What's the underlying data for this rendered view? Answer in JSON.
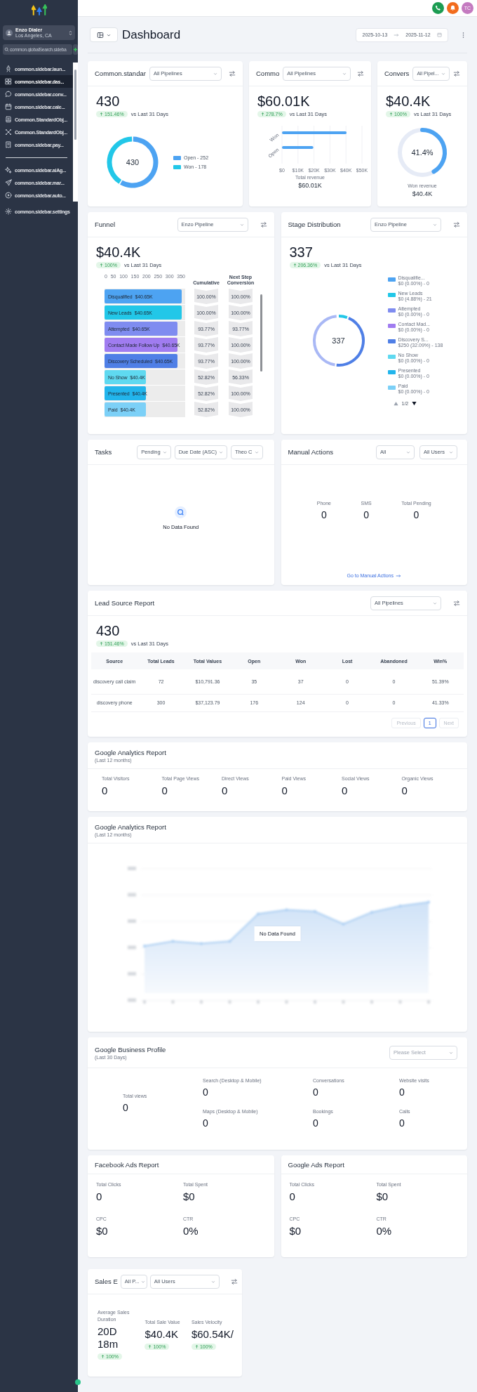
{
  "topbar": {
    "avatar": "TC"
  },
  "sidebar": {
    "workspace": {
      "name": "Enzo Dialer",
      "location": "Los Angeles, CA"
    },
    "search": {
      "placeholder": "common.globalSearch.sideba"
    },
    "nav_groups": [
      {
        "items": [
          {
            "label": "common.sidebar.laun...",
            "selected": false
          },
          {
            "label": "common.sidebar.das...",
            "selected": true
          },
          {
            "label": "common.sidebar.conv...",
            "selected": false
          },
          {
            "label": "common.sidebar.cale...",
            "selected": false
          },
          {
            "label": "Common.StandardObj...",
            "selected": false
          },
          {
            "label": "Common.StandardObj...",
            "selected": false
          },
          {
            "label": "common.sidebar.pay...",
            "selected": false
          }
        ]
      },
      {
        "items": [
          {
            "label": "common.sidebar.aiAg...",
            "selected": false
          },
          {
            "label": "common.sidebar.mar...",
            "selected": false
          },
          {
            "label": "common.sidebar.auto...",
            "selected": false
          }
        ]
      }
    ],
    "footer_items": [
      {
        "label": "common.sidebar.settings",
        "selected": false
      }
    ]
  },
  "header": {
    "title": "Dashboard",
    "date_start": "2025-10-13",
    "date_end": "2025-11-12"
  },
  "opportunities_card": {
    "title": "Common.standar",
    "pipeline": "All Pipelines",
    "value": "430",
    "change": "151.46%",
    "comparison": "vs Last 31 Days",
    "center_label": "430",
    "chart_data": {
      "type": "donut",
      "categories": [
        "Open - 252",
        "Won - 178"
      ],
      "values": [
        58.6,
        41.4
      ],
      "legend": "right"
    }
  },
  "revenue_card": {
    "title": "Commo",
    "pipeline": "All Pipelines",
    "value": "$60.01K",
    "change": "278.7%",
    "comparison": "vs Last 31 Days",
    "chart_data": {
      "type": "bar",
      "orientation": "horizontal",
      "grid": true,
      "categories": [
        "Won",
        "Open"
      ],
      "series": [
        {
          "color": "#4da3f2",
          "values": [
            40.4,
            19.6
          ]
        }
      ],
      "xlim": [
        0,
        50
      ],
      "xticks": [
        {
          "value": 0,
          "label": "$0"
        },
        {
          "value": 10,
          "label": "$10K"
        },
        {
          "value": 20,
          "label": "$20K"
        },
        {
          "value": 30,
          "label": "$30K"
        },
        {
          "value": 40,
          "label": "$40K"
        },
        {
          "value": 50,
          "label": "$50K"
        }
      ]
    },
    "total_label": "Total revenue",
    "total_value": "$60.01K"
  },
  "conversion_card": {
    "title": "Convers",
    "pipeline": "All Pipel...",
    "value": "$40.4K",
    "change": "100%",
    "comparison": "vs Last 31 Days",
    "ring": {
      "level": 0.414,
      "label": "41.4%"
    },
    "caption": "Won revenue",
    "caption_value": "$40.4K"
  },
  "funnel": {
    "title": "Funnel",
    "pipeline": "Enzo Pipeline",
    "value": "$40.4K",
    "change": "100%",
    "comparison": "vs Last 31 Days",
    "axis_ticks": [
      "0",
      "50",
      "100",
      "150",
      "200",
      "250",
      "300",
      "350"
    ],
    "columns": [
      "Cumulative",
      "Next Step Conversion"
    ],
    "stages": [
      {
        "name": "Disqualified",
        "amount": "$40.65K",
        "level": 0.96,
        "color": "#4da3f2",
        "cumulative": "100.00%",
        "next_step": "100.00%"
      },
      {
        "name": "New Leads",
        "amount": "$40.65K",
        "level": 0.96,
        "color": "#22c7e8",
        "cumulative": "100.00%",
        "next_step": "100.00%"
      },
      {
        "name": "Attempted",
        "amount": "$40.65K",
        "level": 0.9,
        "color": "#7f8cf0",
        "cumulative": "93.77%",
        "next_step": "93.77%"
      },
      {
        "name": "Contact Made Follow Up",
        "amount": "$40.65K",
        "level": 0.9,
        "color": "#a07cf0",
        "cumulative": "93.77%",
        "next_step": "100.00%"
      },
      {
        "name": "Discovery Scheduled",
        "amount": "$40.65K",
        "level": 0.9,
        "color": "#4f7fe6",
        "cumulative": "93.77%",
        "next_step": "100.00%"
      },
      {
        "name": "No Show",
        "amount": "$40.4K",
        "level": 0.51,
        "color": "#5fd9f0",
        "cumulative": "52.82%",
        "next_step": "56.33%"
      },
      {
        "name": "Presented",
        "amount": "$40.4K",
        "level": 0.51,
        "color": "#22b5ec",
        "cumulative": "52.82%",
        "next_step": "100.00%"
      },
      {
        "name": "Paid",
        "amount": "$40.4K",
        "level": 0.51,
        "color": "#7cd0f7",
        "cumulative": "52.82%",
        "next_step": "100.00%"
      }
    ]
  },
  "stage_distribution": {
    "title": "Stage Distribution",
    "pipeline": "Enzo Pipeline",
    "value": "337",
    "change": "206.36%",
    "comparison": "vs Last 31 Days",
    "center_label": "337",
    "legend": [
      {
        "name": "Disqualifie...",
        "detail": "$0 (0.00%) - 0",
        "color": "#4da3f2"
      },
      {
        "name": "New Leads",
        "detail": "$0 (4.88%) - 21",
        "color": "#22c7e8"
      },
      {
        "name": "Attempted",
        "detail": "$0 (0.00%) - 0",
        "color": "#7f8cf0"
      },
      {
        "name": "Contact Mad...",
        "detail": "$0 (0.00%) - 0",
        "color": "#a07cf0"
      },
      {
        "name": "Discovery S...",
        "detail": "$250 (32.09%) - 138",
        "color": "#4f7fe6"
      },
      {
        "name": "No Show",
        "detail": "$0 (0.00%) - 0",
        "color": "#5fd9f0"
      },
      {
        "name": "Presented",
        "detail": "$0 (0.00%) - 0",
        "color": "#22b5ec"
      },
      {
        "name": "Paid",
        "detail": "$0 (0.00%) - 0",
        "color": "#7cd0f7"
      }
    ],
    "pager": {
      "label": "1/2",
      "previous_disabled": true,
      "next_disabled": false
    }
  },
  "tasks": {
    "title": "Tasks",
    "filters": [
      "Pending",
      "Due Date (ASC)",
      "Theo C"
    ],
    "empty_text": "No Data Found"
  },
  "manual_actions": {
    "title": "Manual Actions",
    "filters": [
      "All",
      "All Users"
    ],
    "stats": [
      {
        "label": "Phone",
        "value": "0"
      },
      {
        "label": "SMS",
        "value": "0"
      },
      {
        "label": "Total Pending",
        "value": "0"
      }
    ],
    "link": "Go to Manual Actions"
  },
  "lead_source": {
    "title": "Lead Source Report",
    "pipeline": "All Pipelines",
    "value": "430",
    "change": "151.46%",
    "comparison": "vs Last 31 Days",
    "table": {
      "columns": [
        "Source",
        "Total Leads",
        "Total Values",
        "Open",
        "Won",
        "Lost",
        "Abandoned",
        "Win%"
      ],
      "rows": [
        [
          "discovery call claim",
          "72",
          "$10,791.36",
          "35",
          "37",
          "0",
          "0",
          "51.39%"
        ],
        [
          "discovery phone",
          "300",
          "$37,123.79",
          "176",
          "124",
          "0",
          "0",
          "41.33%"
        ]
      ]
    },
    "pagination": {
      "previous": {
        "label": "Previous",
        "disabled": true
      },
      "pages": [
        {
          "label": "1",
          "selected": true
        }
      ],
      "next": {
        "label": "Next",
        "disabled": true
      }
    }
  },
  "analytics_summary": {
    "title": "Google Analytics Report",
    "subtitle": "(Last 12 months)",
    "stats": [
      {
        "label": "Total Visitors",
        "value": "0"
      },
      {
        "label": "Total Page Views",
        "value": "0"
      },
      {
        "label": "Direct Views",
        "value": "0"
      },
      {
        "label": "Paid Views",
        "value": "0"
      },
      {
        "label": "Social Views",
        "value": "0"
      },
      {
        "label": "Organic Views",
        "value": "0"
      }
    ]
  },
  "analytics_chart": {
    "title": "Google Analytics Report",
    "subtitle": "(Last 12 months)",
    "empty_text": "No Data Found"
  },
  "business_profile": {
    "title": "Google Business Profile",
    "subtitle": "(Last 30 Days)",
    "select": {
      "placeholder": "Please Select"
    },
    "total": {
      "label": "Total views",
      "value": "0"
    },
    "stats": [
      {
        "label": "Search (Desktop & Mobile)",
        "value": "0"
      },
      {
        "label": "Conversations",
        "value": "0"
      },
      {
        "label": "Website visits",
        "value": "0"
      },
      {
        "label": "Maps (Desktop & Mobile)",
        "value": "0"
      },
      {
        "label": "Bookings",
        "value": "0"
      },
      {
        "label": "Calls",
        "value": "0"
      }
    ]
  },
  "ads_reports": [
    {
      "title": "Facebook Ads Report",
      "stats": [
        {
          "label": "Total Clicks",
          "value": "0"
        },
        {
          "label": "Total Spent",
          "value": "$0"
        },
        {
          "label": "CPC",
          "value": "$0"
        },
        {
          "label": "CTR",
          "value": "0%"
        }
      ]
    },
    {
      "title": "Google Ads Report",
      "stats": [
        {
          "label": "Total Clicks",
          "value": "0"
        },
        {
          "label": "Total Spent",
          "value": "$0"
        },
        {
          "label": "CPC",
          "value": "$0"
        },
        {
          "label": "CTR",
          "value": "0%"
        }
      ]
    }
  ],
  "sales_efficiency": {
    "title": "Sales E",
    "filters": [
      "All P...",
      "All Users"
    ],
    "stats": [
      {
        "label": "Average Sales Duration",
        "value": "20D 18m",
        "change": "100%"
      },
      {
        "label": "Total Sale Value",
        "value": "$40.4K",
        "change": "100%"
      },
      {
        "label": "Sales Velocity",
        "value": "$60.54K/",
        "change": "100%"
      }
    ]
  }
}
